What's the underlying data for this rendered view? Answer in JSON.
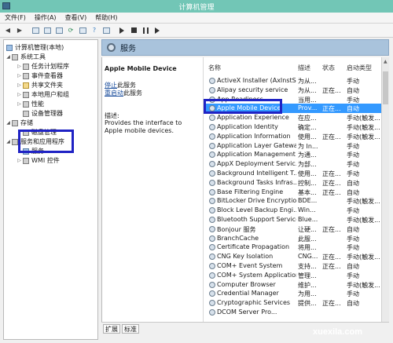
{
  "window": {
    "title": "计算机管理"
  },
  "menu": [
    "文件(F)",
    "操作(A)",
    "查看(V)",
    "帮助(H)"
  ],
  "tree": {
    "root": "计算机管理(本地)",
    "system_tools": "系统工具",
    "task_scheduler": "任务计划程序",
    "event_viewer": "事件查看器",
    "shared_folders": "共享文件夹",
    "local_users": "本地用户和组",
    "performance": "性能",
    "device_manager": "设备管理器",
    "storage": "存储",
    "disk_management": "磁盘管理",
    "services_apps": "服务和应用程序",
    "services": "服务",
    "wmi": "WMI 控件"
  },
  "center": {
    "header": "服务"
  },
  "description": {
    "title": "Apple Mobile Device",
    "stop_link": "停止",
    "stop_suffix": "此服务",
    "restart_link": "重启动",
    "restart_suffix": "此服务",
    "label": "描述:",
    "text": "Provides the interface to Apple mobile devices."
  },
  "columns": {
    "name": "名称",
    "desc": "描述",
    "status": "状态",
    "startup": "启动类型"
  },
  "services": [
    {
      "name": "ActiveX Installer (AxInstSV)",
      "desc": "为从...",
      "status": "",
      "startup": "手动"
    },
    {
      "name": "Alipay security service",
      "desc": "为从...",
      "status": "正在...",
      "startup": "自动"
    },
    {
      "name": "App Readiness",
      "desc": "当用...",
      "status": "",
      "startup": "手动"
    },
    {
      "name": "Apple Mobile Device",
      "desc": "Prov...",
      "status": "正在...",
      "startup": "自动",
      "selected": true
    },
    {
      "name": "Application Experience",
      "desc": "在应...",
      "status": "",
      "startup": "手动(触发..."
    },
    {
      "name": "Application Identity",
      "desc": "确定...",
      "status": "",
      "startup": "手动(触发..."
    },
    {
      "name": "Application Information",
      "desc": "使用...",
      "status": "正在...",
      "startup": "手动(触发..."
    },
    {
      "name": "Application Layer Gatewa...",
      "desc": "为 In...",
      "status": "",
      "startup": "手动"
    },
    {
      "name": "Application Management",
      "desc": "为通...",
      "status": "",
      "startup": "手动"
    },
    {
      "name": "AppX Deployment Servic...",
      "desc": "为部...",
      "status": "",
      "startup": "手动"
    },
    {
      "name": "Background Intelligent T...",
      "desc": "使用...",
      "status": "正在...",
      "startup": "手动"
    },
    {
      "name": "Background Tasks Infras...",
      "desc": "控制...",
      "status": "正在...",
      "startup": "自动"
    },
    {
      "name": "Base Filtering Engine",
      "desc": "基本...",
      "status": "正在...",
      "startup": "自动"
    },
    {
      "name": "BitLocker Drive Encryptio...",
      "desc": "BDE...",
      "status": "",
      "startup": "手动(触发..."
    },
    {
      "name": "Block Level Backup Engi...",
      "desc": "Win...",
      "status": "",
      "startup": "手动"
    },
    {
      "name": "Bluetooth Support Service",
      "desc": "Blue...",
      "status": "",
      "startup": "手动(触发..."
    },
    {
      "name": "Bonjour 服务",
      "desc": "让硬...",
      "status": "正在...",
      "startup": "自动"
    },
    {
      "name": "BranchCache",
      "desc": "此服...",
      "status": "",
      "startup": "手动"
    },
    {
      "name": "Certificate Propagation",
      "desc": "将用...",
      "status": "",
      "startup": "手动"
    },
    {
      "name": "CNG Key Isolation",
      "desc": "CNG...",
      "status": "正在...",
      "startup": "手动(触发..."
    },
    {
      "name": "COM+ Event System",
      "desc": "支持...",
      "status": "正在...",
      "startup": "自动"
    },
    {
      "name": "COM+ System Application",
      "desc": "管理...",
      "status": "",
      "startup": "手动"
    },
    {
      "name": "Computer Browser",
      "desc": "维护...",
      "status": "",
      "startup": "手动(触发..."
    },
    {
      "name": "Credential Manager",
      "desc": "为用...",
      "status": "",
      "startup": "手动"
    },
    {
      "name": "Cryptographic Services",
      "desc": "提供...",
      "status": "正在...",
      "startup": "自动"
    },
    {
      "name": "DCOM Server Pro...",
      "desc": "",
      "status": "",
      "startup": ""
    }
  ],
  "tabs": {
    "extended": "扩展",
    "standard": "标准"
  },
  "watermark": "xuexila.com"
}
